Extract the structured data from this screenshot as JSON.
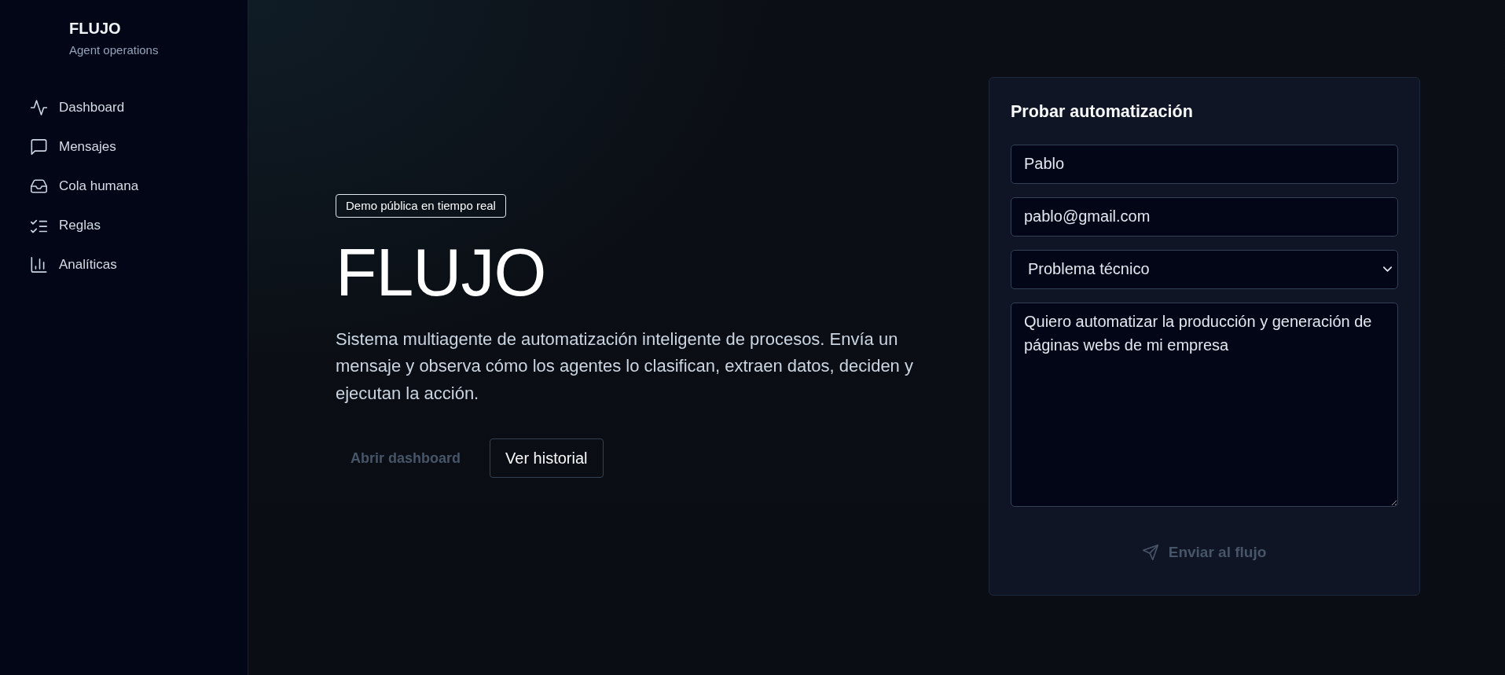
{
  "sidebar": {
    "brand": {
      "name": "FLUJO",
      "tagline": "Agent operations"
    },
    "items": [
      {
        "label": "Dashboard"
      },
      {
        "label": "Mensajes"
      },
      {
        "label": "Cola humana"
      },
      {
        "label": "Reglas"
      },
      {
        "label": "Analíticas"
      }
    ]
  },
  "hero": {
    "badge": "Demo pública en tiempo real",
    "title": "FLUJO",
    "description": "Sistema multiagente de automatización inteligente de procesos. Envía un mensaje y observa cómo los agentes lo clasifican, extraen datos, deciden y ejecutan la acción.",
    "buttons": [
      {
        "label": "Abrir dashboard",
        "kind": "primary"
      },
      {
        "label": "Ver historial",
        "kind": "outline"
      }
    ]
  },
  "form": {
    "title": "Probar automatización",
    "fields": [
      {
        "kind": "input",
        "value": "Pablo"
      },
      {
        "kind": "input",
        "value": "pablo@gmail.com"
      },
      {
        "kind": "select",
        "value": "Problema técnico"
      },
      {
        "kind": "textarea",
        "value": "Quiero automatizar la producción y generación de páginas webs de mi empresa"
      }
    ],
    "submit": {
      "label": "Enviar al flujo",
      "kind": "primary"
    }
  }
}
